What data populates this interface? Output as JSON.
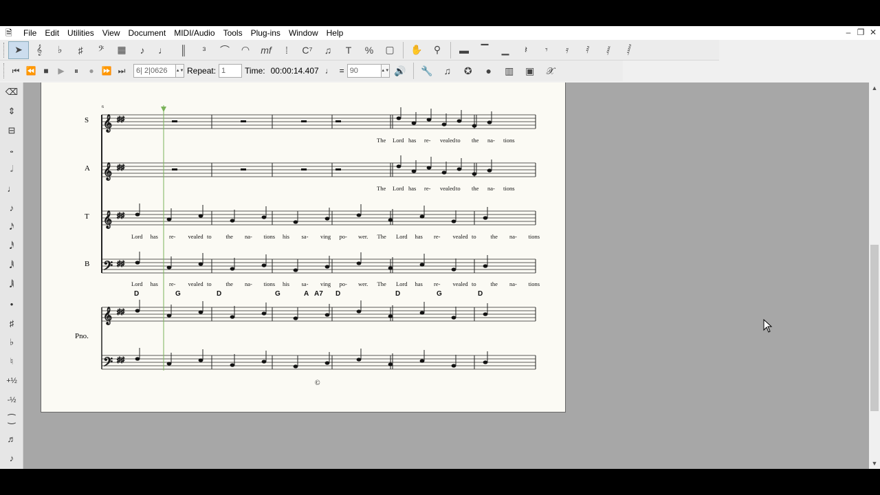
{
  "menu": [
    "File",
    "Edit",
    "Utilities",
    "View",
    "Document",
    "MIDI/Audio",
    "Tools",
    "Plug-ins",
    "Window",
    "Help"
  ],
  "window_controls": [
    "–",
    "❐",
    "✕"
  ],
  "transport": {
    "position": "6| 2|0626",
    "repeat_label": "Repeat:",
    "repeat_value": "1",
    "time_label": "Time:",
    "time_value": "00:00:14.407",
    "tempo_equals": "=",
    "tempo_value": "90"
  },
  "score": {
    "measure_number": "6",
    "staff_labels": {
      "s": "S",
      "a": "A",
      "t": "T",
      "b": "B",
      "pno": "Pno."
    },
    "lyrics_sa": [
      "The",
      "Lord",
      "has",
      "re-",
      "vealed",
      "to",
      "the",
      "na-",
      "tions"
    ],
    "lyrics_t": [
      "Lord",
      "has",
      "re-",
      "vealed",
      "to",
      "the",
      "na-",
      "tions",
      "his",
      "sa-",
      "ving",
      "po-",
      "wer.",
      "The",
      "Lord",
      "has",
      "re-",
      "vealed",
      "to",
      "the",
      "na-",
      "tions"
    ],
    "chords": [
      "D",
      "G",
      "D",
      "G",
      "A",
      "A7",
      "D",
      "D",
      "G",
      "D"
    ],
    "copyright": "©"
  },
  "palette_icons": [
    "eraser-icon",
    "move-icon",
    "hairpin-icon",
    "whole-note-icon",
    "half-note-icon",
    "quarter-note-icon",
    "eighth-note-icon",
    "sixteenth-note-icon",
    "thirtysecond-note-icon",
    "sixtyfourth-note-icon",
    "128th-note-icon",
    "dot-icon",
    "sharp-icon",
    "flat-icon",
    "natural-icon",
    "half-step-up-icon",
    "half-step-down-icon",
    "tie-icon",
    "tuplet-icon",
    "grace-note-icon"
  ]
}
